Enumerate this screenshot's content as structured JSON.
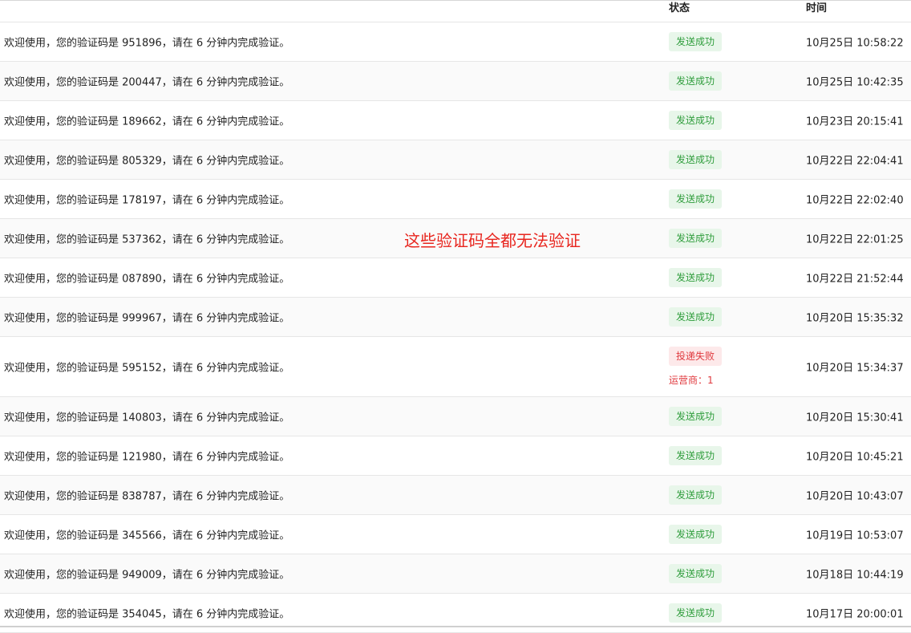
{
  "header": {
    "status": "状态",
    "time": "时间"
  },
  "annotation": "这些验证码全都无法验证",
  "rows": [
    {
      "message": "欢迎使用，您的验证码是 951896，请在 6 分钟内完成验证。",
      "status": "发送成功",
      "time": "10月25日 10:58:22"
    },
    {
      "message": "欢迎使用，您的验证码是 200447，请在 6 分钟内完成验证。",
      "status": "发送成功",
      "time": "10月25日 10:42:35"
    },
    {
      "message": "欢迎使用，您的验证码是 189662，请在 6 分钟内完成验证。",
      "status": "发送成功",
      "time": "10月23日 20:15:41"
    },
    {
      "message": "欢迎使用，您的验证码是 805329，请在 6 分钟内完成验证。",
      "status": "发送成功",
      "time": "10月22日 22:04:41"
    },
    {
      "message": "欢迎使用，您的验证码是 178197，请在 6 分钟内完成验证。",
      "status": "发送成功",
      "time": "10月22日 22:02:40"
    },
    {
      "message": "欢迎使用，您的验证码是 537362，请在 6 分钟内完成验证。",
      "status": "发送成功",
      "time": "10月22日 22:01:25"
    },
    {
      "message": "欢迎使用，您的验证码是 087890，请在 6 分钟内完成验证。",
      "status": "发送成功",
      "time": "10月22日 21:52:44"
    },
    {
      "message": "欢迎使用，您的验证码是 999967，请在 6 分钟内完成验证。",
      "status": "发送成功",
      "time": "10月20日 15:35:32"
    },
    {
      "message": "欢迎使用，您的验证码是 595152，请在 6 分钟内完成验证。",
      "status": "投递失败",
      "carrier": "运营商：1",
      "time": "10月20日 15:34:37"
    },
    {
      "message": "欢迎使用，您的验证码是 140803，请在 6 分钟内完成验证。",
      "status": "发送成功",
      "time": "10月20日 15:30:41"
    },
    {
      "message": "欢迎使用，您的验证码是 121980，请在 6 分钟内完成验证。",
      "status": "发送成功",
      "time": "10月20日 10:45:21"
    },
    {
      "message": "欢迎使用，您的验证码是 838787，请在 6 分钟内完成验证。",
      "status": "发送成功",
      "time": "10月20日 10:43:07"
    },
    {
      "message": "欢迎使用，您的验证码是 345566，请在 6 分钟内完成验证。",
      "status": "发送成功",
      "time": "10月19日 10:53:07"
    },
    {
      "message": "欢迎使用，您的验证码是 949009，请在 6 分钟内完成验证。",
      "status": "发送成功",
      "time": "10月18日 10:44:19"
    },
    {
      "message": "欢迎使用，您的验证码是 354045，请在 6 分钟内完成验证。",
      "status": "发送成功",
      "time": "10月17日 20:00:01"
    }
  ],
  "colors": {
    "success_text": "#2f9d3c",
    "success_bg": "#e8f6ea",
    "fail_text": "#e0393e",
    "fail_bg": "#fde9ea",
    "annotation": "#e8261f"
  }
}
